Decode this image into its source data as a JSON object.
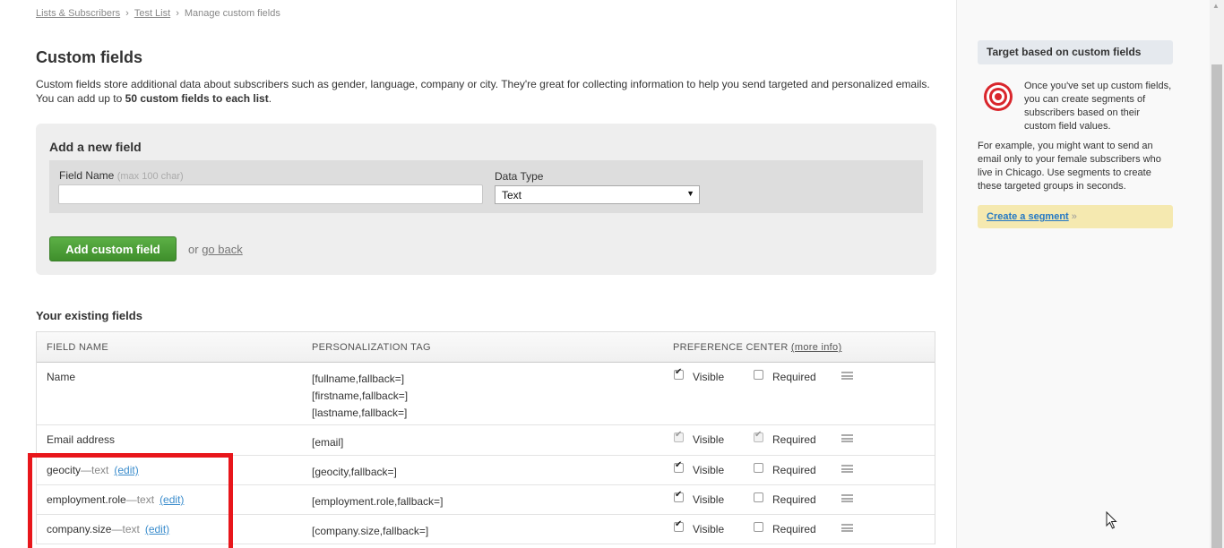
{
  "breadcrumb": {
    "items": [
      "Lists & Subscribers",
      "Test List"
    ],
    "current": "Manage custom fields",
    "separator": "›"
  },
  "page": {
    "title": "Custom fields",
    "intro_line1": "Custom fields store additional data about subscribers such as gender, language, company or city. They're great for collecting information to help you send targeted and personalized emails.",
    "intro_line2_prefix": "You can add up to ",
    "intro_line2_bold": "50 custom fields to each list",
    "intro_line2_suffix": "."
  },
  "add_field": {
    "title": "Add a new field",
    "field_name_label": "Field Name",
    "field_name_hint": "(max 100 char)",
    "field_name_value": "",
    "data_type_label": "Data Type",
    "data_type_value": "Text",
    "add_button": "Add custom field",
    "or_text": "or",
    "go_back": "go back"
  },
  "existing": {
    "title": "Your existing fields",
    "columns": {
      "field_name": "FIELD NAME",
      "personalization_tag": "PERSONALIZATION TAG",
      "preference_center": "PREFERENCE CENTER",
      "more_info": "(more info)"
    },
    "labels": {
      "visible": "Visible",
      "required": "Required",
      "edit": "(edit)"
    },
    "rows": [
      {
        "name": "Name",
        "type": "",
        "tags": [
          "[fullname,fallback=]",
          "[firstname,fallback=]",
          "[lastname,fallback=]"
        ],
        "visible": true,
        "required": false,
        "locked": false,
        "editable": false
      },
      {
        "name": "Email address",
        "type": "",
        "tags": [
          "[email]"
        ],
        "visible": true,
        "required": true,
        "locked": true,
        "editable": false
      },
      {
        "name": "geocity",
        "type": "—text",
        "tags": [
          "[geocity,fallback=]"
        ],
        "visible": true,
        "required": false,
        "locked": false,
        "editable": true
      },
      {
        "name": "employment.role",
        "type": "—text",
        "tags": [
          "[employment.role,fallback=]"
        ],
        "visible": true,
        "required": false,
        "locked": false,
        "editable": true
      },
      {
        "name": "company.size",
        "type": "—text",
        "tags": [
          "[company.size,fallback=]"
        ],
        "visible": true,
        "required": false,
        "locked": false,
        "editable": true
      }
    ]
  },
  "sidebar": {
    "heading": "Target based on custom fields",
    "para1": "Once you've set up custom fields, you can create segments of subscribers based on their custom field values.",
    "para2": "For example, you might want to send an email only to your female subscribers who live in Chicago. Use segments to create these targeted groups in seconds.",
    "cta_link": "Create a segment",
    "cta_suffix": "»"
  },
  "colors": {
    "add_button": "#4a9a36",
    "highlight": "#e8161b",
    "link_blue": "#2478c4",
    "cta_bg": "#f5e9b0"
  },
  "icons": [
    "target-icon",
    "chevron-down-icon",
    "drag-handle-icon",
    "mouse-cursor-icon"
  ]
}
